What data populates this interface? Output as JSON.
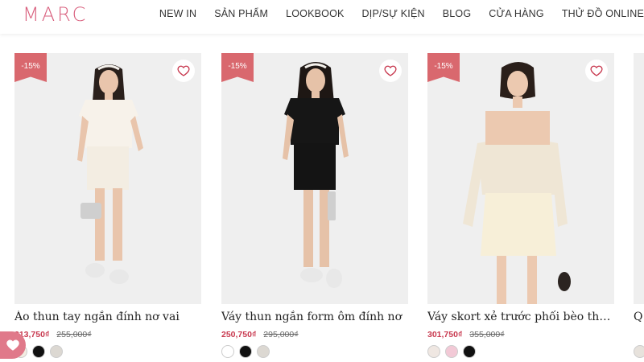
{
  "brand": {
    "logo": "MARC",
    "accent": "#d9607e"
  },
  "nav": [
    "NEW IN",
    "SẢN PHẨM",
    "LOOKBOOK",
    "DỊP/SỰ KIỆN",
    "BLOG",
    "CỬA HÀNG",
    "THỬ ĐỒ ONLINE"
  ],
  "products": [
    {
      "name": "Áo thun tay ngắn đính nơ vai",
      "badge": "-15%",
      "price": "213,750₫",
      "old_price": "255,000₫",
      "swatches": [
        "#f3ede2",
        "#111111",
        "#dcd8d2"
      ]
    },
    {
      "name": "Váy thun ngắn form ôm đính nơ",
      "badge": "-15%",
      "price": "250,750₫",
      "old_price": "295,000₫",
      "swatches": [
        "#ffffff",
        "#111111",
        "#dcd8d2"
      ]
    },
    {
      "name": "Váy skort xẻ trước phối bèo thất...",
      "badge": "-15%",
      "price": "301,750₫",
      "old_price": "355,000₫",
      "swatches": [
        "#efe7e2",
        "#f2c9d6",
        "#111111"
      ]
    },
    {
      "name": "Q",
      "badge": "",
      "price": "",
      "old_price": "",
      "swatches": [
        "#e7e2dc"
      ]
    }
  ],
  "icons": {
    "wishlist": "heart-icon",
    "fab": "heart-icon"
  }
}
